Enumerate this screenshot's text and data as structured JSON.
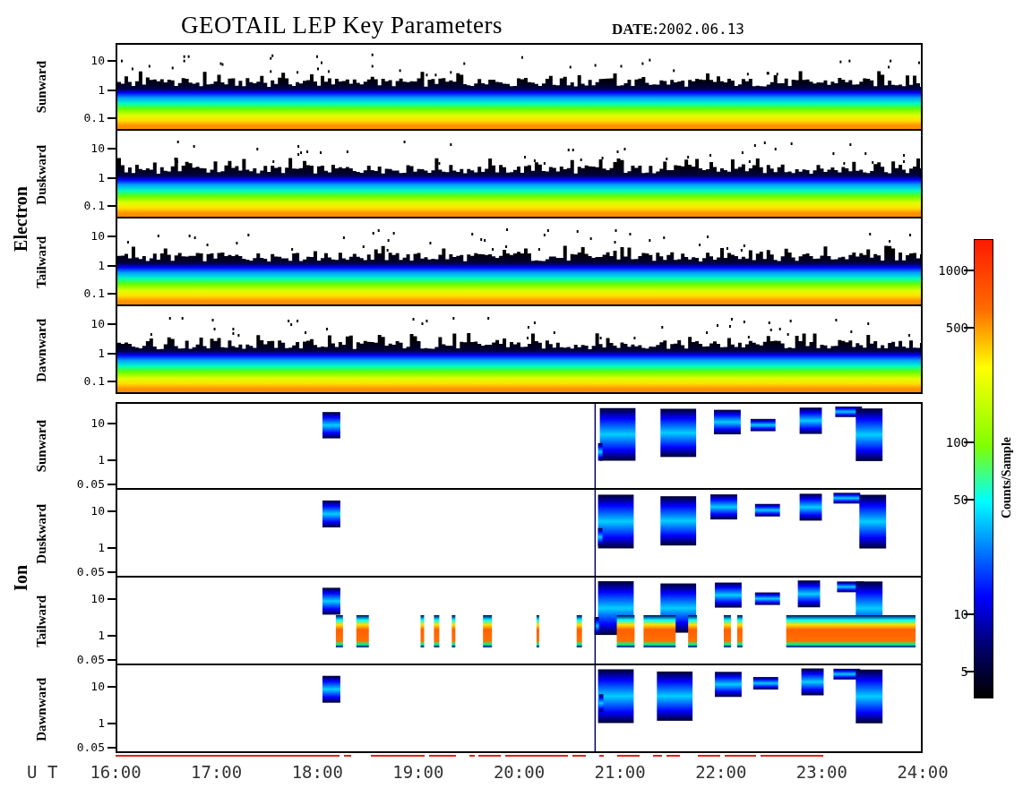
{
  "title": "GEOTAIL LEP Key Parameters",
  "date_label": "DATE:",
  "date": "2002.06.13",
  "groups": [
    {
      "label": "Electron",
      "kind": "electron",
      "panels": [
        {
          "label": "Sunward",
          "yticks": [
            "10",
            "1",
            "0.1"
          ]
        },
        {
          "label": "Duskward",
          "yticks": [
            "10",
            "1",
            "0.1"
          ]
        },
        {
          "label": "Tailward",
          "yticks": [
            "10",
            "1",
            "0.1"
          ]
        },
        {
          "label": "Dawnward",
          "yticks": [
            "10",
            "1",
            "0.1"
          ]
        }
      ]
    },
    {
      "label": "Ion",
      "kind": "ion",
      "panels": [
        {
          "label": "Sunward",
          "yticks": [
            "10",
            "1",
            "0.05"
          ]
        },
        {
          "label": "Duskward",
          "yticks": [
            "10",
            "1",
            "0.05"
          ]
        },
        {
          "label": "Tailward",
          "yticks": [
            "10",
            "1",
            "0.05"
          ]
        },
        {
          "label": "Dawnward",
          "yticks": [
            "10",
            "1",
            "0.05"
          ]
        }
      ]
    }
  ],
  "x_axis": {
    "label": "U T",
    "ticks": [
      "16:00",
      "17:00",
      "18:00",
      "19:00",
      "20:00",
      "21:00",
      "22:00",
      "23:00",
      "24:00"
    ]
  },
  "colorbar": {
    "label": "Counts/Sample",
    "ticks": [
      "1000",
      "500",
      "100",
      "50",
      "10",
      "5"
    ]
  }
}
